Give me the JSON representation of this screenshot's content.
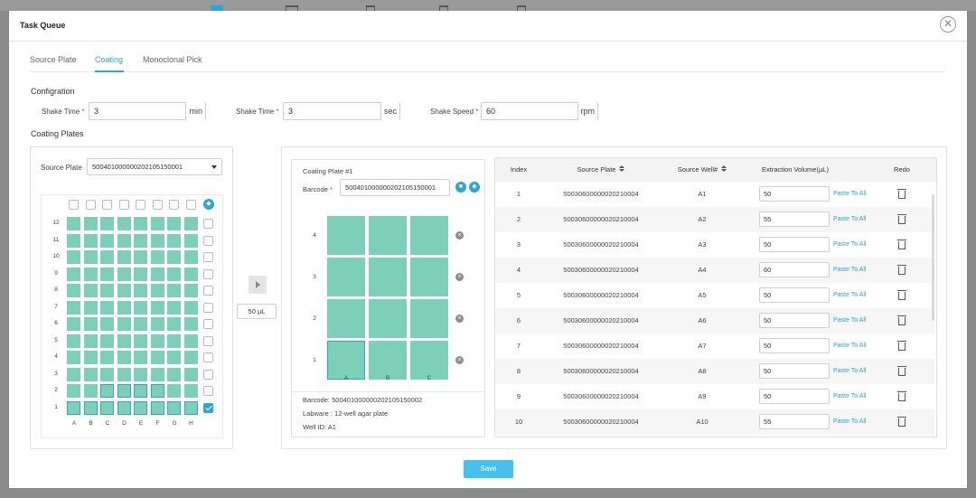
{
  "modal": {
    "title": "Task Queue",
    "close_glyph": "✕"
  },
  "tabs": [
    "Source Plate",
    "Coating",
    "Monoclonal Pick"
  ],
  "configuration": {
    "label": "Configration",
    "fields": [
      {
        "label": "Shake Time",
        "required": "*",
        "value": "3",
        "unit": "min"
      },
      {
        "label": "Shake Time",
        "required": "*",
        "value": "3",
        "unit": "sec"
      },
      {
        "label": "Shake Speed",
        "required": "*",
        "value": "60",
        "unit": "rpm"
      }
    ]
  },
  "coating_plates_label": "Coating Plates",
  "source_plate": {
    "label": "Source Plate",
    "value": "5004010000002021051500​01",
    "rows": [
      "12",
      "11",
      "10",
      "9",
      "8",
      "7",
      "6",
      "5",
      "4",
      "3",
      "2",
      "1"
    ],
    "cols": [
      "A",
      "B",
      "C",
      "D",
      "E",
      "F",
      "G",
      "H"
    ],
    "checked_row": "1"
  },
  "transfer": {
    "volume": "50 µL"
  },
  "coating_plate": {
    "title": "Coating Plate #1",
    "barcode_label": "Barcode",
    "required": "*",
    "barcode_value": "500401000000202105150001",
    "rows": [
      "4",
      "3",
      "2",
      "1"
    ],
    "cols": [
      "A",
      "B",
      "C"
    ],
    "info": {
      "barcode": "Barcode: 500401000000202105150002",
      "labware": "Labware : 12-well agar plate",
      "well_id": "Well ID: A1"
    }
  },
  "table": {
    "headers": {
      "index": "Index",
      "source_plate": "Source Plate",
      "source_well": "Source Well#",
      "volume": "Extraction Volume(µL)",
      "redo": "Redo"
    },
    "paste_label": "Paste To All",
    "rows": [
      {
        "index": "1",
        "plate": "500306000000202100​04",
        "well": "A1",
        "volume": "50"
      },
      {
        "index": "2",
        "plate": "50030600000020210004",
        "well": "A2",
        "volume": "55"
      },
      {
        "index": "3",
        "plate": "50030600000020210004",
        "well": "A3",
        "volume": "50"
      },
      {
        "index": "4",
        "plate": "50030600000020210004",
        "well": "A4",
        "volume": "60"
      },
      {
        "index": "5",
        "plate": "50030600000020210004",
        "well": "A5",
        "volume": "50"
      },
      {
        "index": "6",
        "plate": "50030600000020210004",
        "well": "A6",
        "volume": "50"
      },
      {
        "index": "7",
        "plate": "50030600000020210004",
        "well": "A7",
        "volume": "50"
      },
      {
        "index": "8",
        "plate": "50030600000020210004",
        "well": "A8",
        "volume": "50"
      },
      {
        "index": "9",
        "plate": "50030600000020210004",
        "well": "A9",
        "volume": "50"
      },
      {
        "index": "10",
        "plate": "50030600000020210004",
        "well": "A10",
        "volume": "55"
      }
    ]
  },
  "footer": {
    "save_label": "Save"
  },
  "colors": {
    "accent": "#2fa4d6",
    "well_fill": "#7ecfb7",
    "save_button": "#46c0ec"
  }
}
